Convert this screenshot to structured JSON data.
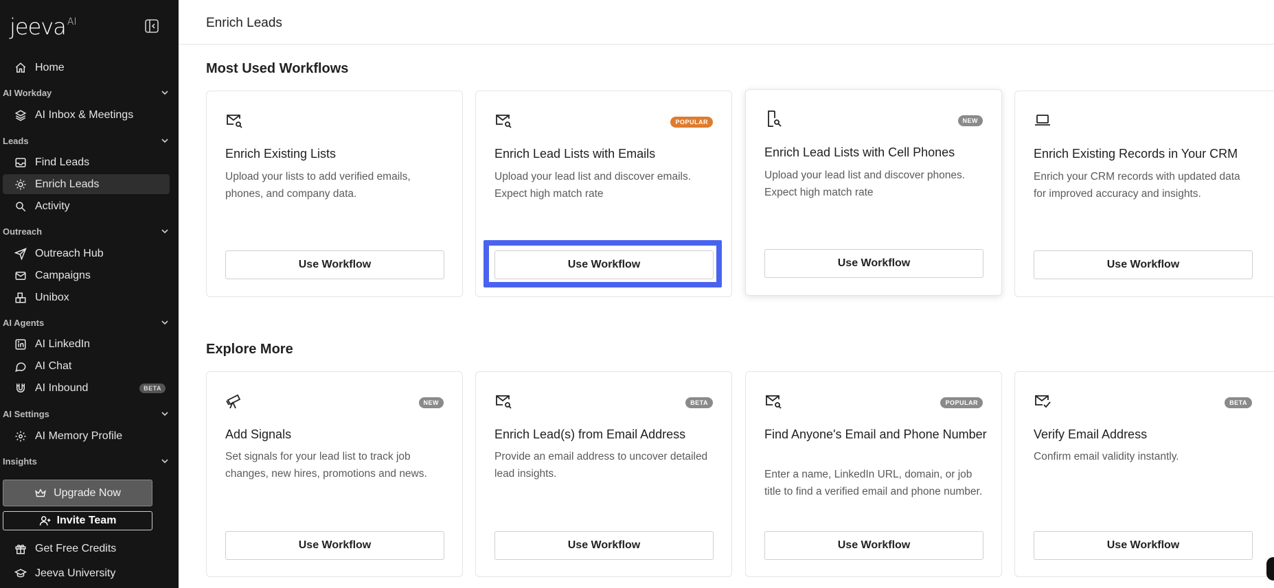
{
  "app": {
    "logo_text": "jeeva",
    "logo_sup": "AI"
  },
  "sidebar": {
    "items": [
      {
        "label": "Home",
        "icon": "home-icon"
      },
      {
        "label": "AI Inbox & Meetings",
        "icon": "layers-icon"
      },
      {
        "label": "Find Leads",
        "icon": "inbox-icon"
      },
      {
        "label": "Enrich Leads",
        "icon": "lightbulb-icon",
        "active": true
      },
      {
        "label": "Activity",
        "icon": "search-icon"
      },
      {
        "label": "Outreach Hub",
        "icon": "send-icon"
      },
      {
        "label": "Campaigns",
        "icon": "mail-icon"
      },
      {
        "label": "Unibox",
        "icon": "blocks-icon"
      },
      {
        "label": "AI LinkedIn",
        "icon": "linkedin-icon"
      },
      {
        "label": "AI Chat",
        "icon": "chat-icon"
      },
      {
        "label": "AI Inbound",
        "icon": "magnet-icon",
        "badge": "BETA"
      },
      {
        "label": "AI Memory Profile",
        "icon": "gear-brain-icon"
      }
    ],
    "sections": [
      "AI Workday",
      "Leads",
      "Outreach",
      "AI Agents",
      "AI Settings",
      "Insights"
    ],
    "upgrade_label": "Upgrade Now",
    "invite_label": "Invite Team",
    "footer": [
      {
        "label": "Get Free Credits",
        "icon": "gift-icon"
      },
      {
        "label": "Jeeva University",
        "icon": "graduation-cap-icon"
      }
    ]
  },
  "main": {
    "page_title": "Enrich Leads",
    "most_used_title": "Most Used Workflows",
    "explore_title": "Explore More",
    "button_label": "Use Workflow",
    "most_used": [
      {
        "title": "Enrich Existing Lists",
        "desc": "Upload your lists to add verified emails, phones, and company data.",
        "icon": "mail-search-icon"
      },
      {
        "title": "Enrich Lead Lists with Emails",
        "desc": "Upload your lead list and discover emails. Expect high match rate",
        "badge": "POPULAR",
        "icon": "mail-search-icon"
      },
      {
        "title": "Enrich Lead Lists with Cell Phones",
        "desc": "Upload your lead list and discover phones. Expect high match rate",
        "badge": "NEW",
        "icon": "phone-search-icon"
      },
      {
        "title": "Enrich Existing Records in Your CRM",
        "desc": "Enrich your CRM records with updated data for improved accuracy and insights.",
        "icon": "laptop-icon"
      }
    ],
    "explore": [
      {
        "title": "Add Signals",
        "desc": "Set signals for your lead list to track job changes, new hires, promotions and news.",
        "badge": "NEW",
        "icon": "telescope-icon"
      },
      {
        "title": "Enrich Lead(s) from Email Address",
        "desc": "Provide an email address to uncover detailed lead insights.",
        "badge": "BETA",
        "icon": "mail-search-icon"
      },
      {
        "title": "Find Anyone's Email and Phone Number",
        "desc": "Enter a name, LinkedIn URL, domain, or job title to find a verified email and phone number.",
        "badge": "POPULAR",
        "icon": "mail-search-icon"
      },
      {
        "title": "Verify Email Address",
        "desc": "Confirm email validity instantly.",
        "badge": "BETA",
        "icon": "mail-check-icon"
      }
    ]
  },
  "colors": {
    "sidebar_bg": "#151515",
    "active_item_bg": "#2f2f2f",
    "badge_popular": "#e07b2d",
    "badge_new": "#8a8a8a",
    "badge_beta": "#8a8a8a",
    "highlight": "#4a63ef"
  }
}
